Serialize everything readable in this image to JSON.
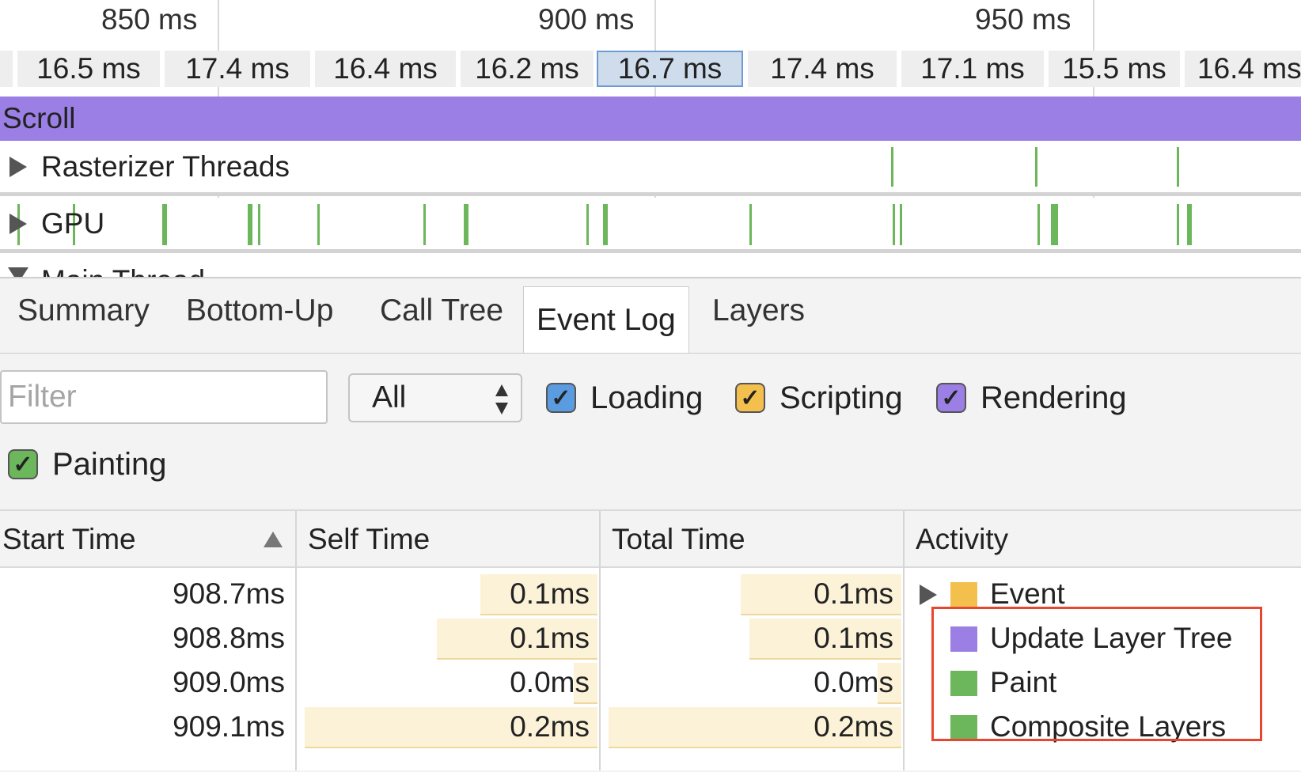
{
  "timeline": {
    "time_labels": [
      "850 ms",
      "900 ms",
      "950 ms"
    ],
    "frames": [
      "16.5 ms",
      "17.4 ms",
      "16.4 ms",
      "16.2 ms",
      "16.7 ms",
      "17.4 ms",
      "17.1 ms",
      "15.5 ms",
      "16.4 ms"
    ],
    "selected_frame_index": 4,
    "scroll_label": "Scroll",
    "tracks": {
      "rasterizer": "Rasterizer Threads",
      "gpu": "GPU",
      "main": "Main Thread"
    }
  },
  "panel": {
    "tabs": [
      "Summary",
      "Bottom-Up",
      "Call Tree",
      "Event Log",
      "Layers"
    ],
    "active_tab": "Event Log",
    "filter_placeholder": "Filter",
    "select_value": "All",
    "categories": [
      {
        "label": "Loading",
        "checked": true,
        "color": "#5b9be0"
      },
      {
        "label": "Scripting",
        "checked": true,
        "color": "#f3c04e"
      },
      {
        "label": "Rendering",
        "checked": true,
        "color": "#9b7fe4"
      },
      {
        "label": "Painting",
        "checked": true,
        "color": "#6cb65c"
      }
    ]
  },
  "table": {
    "columns": [
      "Start Time",
      "Self Time",
      "Total Time",
      "Activity"
    ],
    "sort_column": "Start Time",
    "sort_direction": "ascending",
    "rows": [
      {
        "start": "908.7ms",
        "self": "0.1ms",
        "total": "0.1ms",
        "activity": "Event",
        "color": "#f3c04e",
        "expandable": true,
        "self_frac": 0.4,
        "total_frac": 0.55
      },
      {
        "start": "908.8ms",
        "self": "0.1ms",
        "total": "0.1ms",
        "activity": "Update Layer Tree",
        "color": "#9b7fe4",
        "expandable": false,
        "self_frac": 0.55,
        "total_frac": 0.52
      },
      {
        "start": "909.0ms",
        "self": "0.0ms",
        "total": "0.0ms",
        "activity": "Paint",
        "color": "#6cb65c",
        "expandable": false,
        "self_frac": 0.08,
        "total_frac": 0.08
      },
      {
        "start": "909.1ms",
        "self": "0.2ms",
        "total": "0.2ms",
        "activity": "Composite Layers",
        "color": "#6cb65c",
        "expandable": false,
        "self_frac": 1.0,
        "total_frac": 1.0
      }
    ]
  }
}
